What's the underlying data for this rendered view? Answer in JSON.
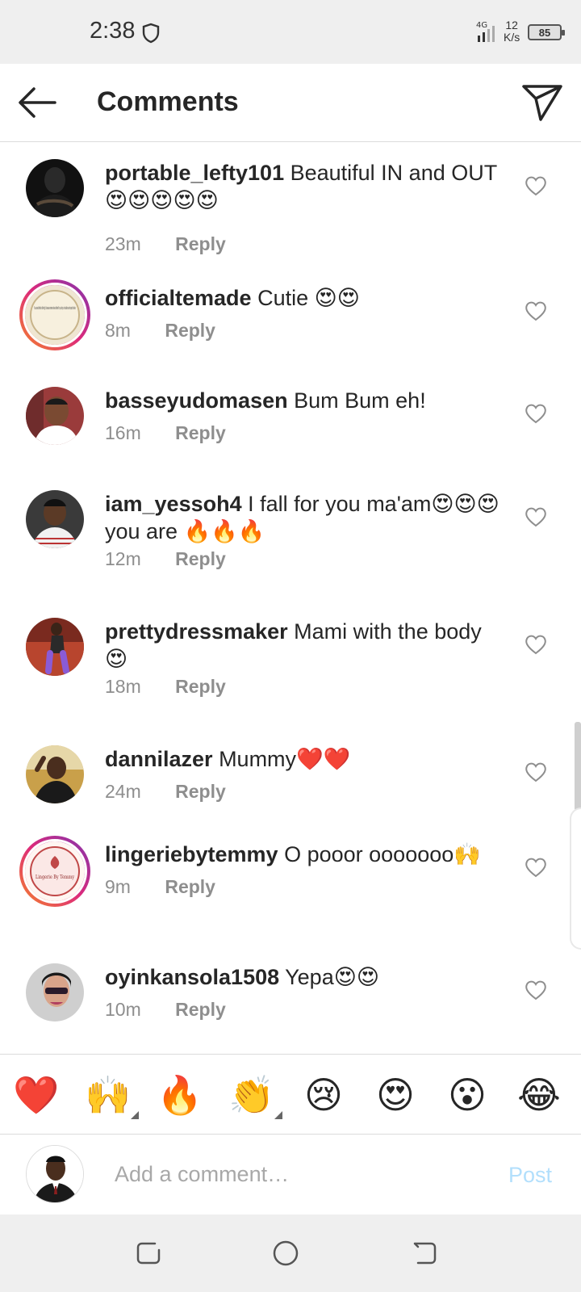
{
  "status_bar": {
    "time": "2:38",
    "network": "4G",
    "speed_value": "12",
    "speed_unit": "K/s",
    "battery": "85"
  },
  "header": {
    "title": "Comments"
  },
  "comments": [
    {
      "username": "portable_lefty101",
      "text": "Beautiful IN and OUT 😍😍😍😍😍",
      "time": "23m",
      "reply": "Reply"
    },
    {
      "username": "officialtemade",
      "text": "Cutie 😍😍",
      "time": "8m",
      "reply": "Reply"
    },
    {
      "username": "basseyudomasen",
      "text": "Bum Bum eh!",
      "time": "16m",
      "reply": "Reply"
    },
    {
      "username": "iam_yessoh4",
      "text": "I fall for you ma'am😍😍😍you are 🔥🔥🔥",
      "time": "12m",
      "reply": "Reply"
    },
    {
      "username": "prettydressmaker",
      "text": "Mami with the body 😍",
      "time": "18m",
      "reply": "Reply"
    },
    {
      "username": "dannilazer",
      "text": "Mummy❤️❤️",
      "time": "24m",
      "reply": "Reply"
    },
    {
      "username": "lingeriebytemmy",
      "text": "O pooor ooooooo🙌",
      "time": "9m",
      "reply": "Reply"
    },
    {
      "username": "oyinkansola1508",
      "text": "Yepa😍😍",
      "time": "10m",
      "reply": "Reply"
    }
  ],
  "avatar_texts": {
    "officialtemade": "If u succeed without suffering,it is because someone have suffered for u,so drop ur shoulders and respect hustlers.",
    "lingeriebytemmy": "Lingerie By Temmy"
  },
  "emoji_bar": [
    "❤️",
    "🙌",
    "🔥",
    "👏",
    "😢",
    "😍",
    "😮",
    "😂"
  ],
  "add_comment": {
    "placeholder": "Add a comment…",
    "post_label": "Post"
  }
}
